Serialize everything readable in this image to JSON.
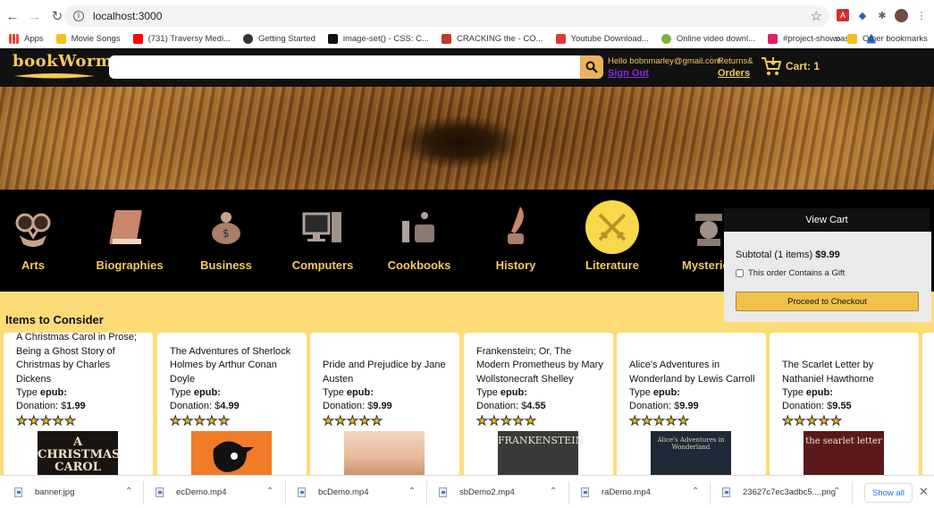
{
  "browser": {
    "url": "localhost:3000",
    "bookmarks": [
      {
        "label": "Apps",
        "color": "#4285f4"
      },
      {
        "label": "Movie Songs",
        "color": "#f4c20d"
      },
      {
        "label": "(731) Traversy Medi...",
        "color": "#ff0000"
      },
      {
        "label": "Getting Started",
        "color": "#333333"
      },
      {
        "label": "image-set() - CSS: C...",
        "color": "#111111"
      },
      {
        "label": "CRACKING the - CO...",
        "color": "#c0392b"
      },
      {
        "label": "Youtube Download...",
        "color": "#e53935"
      },
      {
        "label": "Online video downl...",
        "color": "#7cb342"
      },
      {
        "label": "#project-showcase",
        "color": "#e91e63"
      },
      {
        "label": "",
        "color": "#1a73e8"
      }
    ],
    "more_bookmarks": "»",
    "other_bookmarks": "Other bookmarks"
  },
  "header": {
    "logo": "bookWorm",
    "search_value": "",
    "hello": "Hello bobnmarley@gmail.com",
    "signout": "Sign Out",
    "returns": "Returns&",
    "orders": "Orders",
    "cart_label": "Cart: 1"
  },
  "categories": [
    {
      "label": "Arts",
      "icon": "mask-icon"
    },
    {
      "label": "Biographies",
      "icon": "book-icon"
    },
    {
      "label": "Business",
      "icon": "piggy-bank-icon"
    },
    {
      "label": "Computers",
      "icon": "computer-icon"
    },
    {
      "label": "Cookbooks",
      "icon": "cooking-pot-icon"
    },
    {
      "label": "History",
      "icon": "quill-icon"
    },
    {
      "label": "Literature",
      "icon": "crossed-swords-icon",
      "active": true
    },
    {
      "label": "Mysteries",
      "icon": "detective-icon"
    }
  ],
  "items": {
    "title": "Items to Consider",
    "type_label": "Type",
    "donation_label": "Donation: $",
    "books": [
      {
        "title": "A Christmas Carol in Prose; Being a Ghost Story of Christmas by Charles Dickens",
        "type": "epub:",
        "price": "1.99",
        "stars": "★★★★★",
        "cover_text": "A CHRISTMAS CAROL"
      },
      {
        "title": "The Adventures of Sherlock Holmes by Arthur Conan Doyle",
        "type": "epub:",
        "price": "4.99",
        "stars": "★★★★★",
        "cover_text": ""
      },
      {
        "title": "Pride and Prejudice by Jane Austen",
        "type": "epub:",
        "price": "9.99",
        "stars": "★★★★★",
        "cover_text": ""
      },
      {
        "title": "Frankenstein; Or, The Modern Prometheus by Mary Wollstonecraft Shelley",
        "type": "epub:",
        "price": "4.55",
        "stars": "★★★★★",
        "cover_text": "FRANKENSTEIN"
      },
      {
        "title": "Alice's Adventures in Wonderland by Lewis Carroll",
        "type": "epub:",
        "price": "9.99",
        "stars": "★★★★★",
        "cover_text": "Alice's Adventures in Wonderland"
      },
      {
        "title": "The Scarlet Letter by Nathaniel Hawthorne",
        "type": "epub:",
        "price": "9.55",
        "stars": "★★★★★",
        "cover_text": "the searlet letter"
      }
    ]
  },
  "view_cart": {
    "title": "View Cart",
    "subtotal_label": "Subtotal (1 items)",
    "subtotal_value": "$9.99",
    "gift_label": "This order Contains a Gift",
    "checkout_label": "Proceed to Checkout"
  },
  "downloads": {
    "files": [
      "banner.jpg",
      "ecDemo.mp4",
      "bcDemo.mp4",
      "sbDemo2.mp4",
      "raDemo.mp4",
      "23627c7ec3adbc5....png"
    ],
    "show_all": "Show all"
  }
}
